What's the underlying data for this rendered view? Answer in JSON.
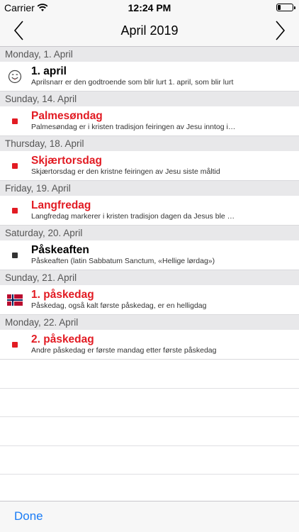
{
  "status_bar": {
    "carrier": "Carrier",
    "time": "12:24 PM",
    "battery_level": 0.22
  },
  "nav": {
    "title": "April 2019"
  },
  "colors": {
    "red": "#e21b23",
    "dark": "#333333",
    "link": "#1a7cf5"
  },
  "sections": [
    {
      "header": "Monday, 1. April",
      "event": {
        "title": "1. april",
        "subtitle": "Aprilsnarr er den godtroende som blir lurt 1. april, som blir lurt",
        "icon": "smiley-icon",
        "color": "#000000"
      }
    },
    {
      "header": "Sunday, 14. April",
      "event": {
        "title": "Palmesøndag",
        "subtitle": "Palmesøndag er i kristen tradisjon feiringen av Jesu inntog i Jerusalem",
        "icon": "red-square-icon",
        "color": "#e21b23"
      }
    },
    {
      "header": "Thursday, 18. April",
      "event": {
        "title": "Skjærtorsdag",
        "subtitle": "Skjærtorsdag er den kristne feiringen av Jesu siste måltid",
        "icon": "red-square-icon",
        "color": "#e21b23"
      }
    },
    {
      "header": "Friday, 19. April",
      "event": {
        "title": "Langfredag",
        "subtitle": "Langfredag markerer i kristen tradisjon dagen da Jesus ble korsfestet",
        "icon": "red-square-icon",
        "color": "#e21b23"
      }
    },
    {
      "header": "Saturday, 20. April",
      "event": {
        "title": "Påskeaften",
        "subtitle": "Påskeaften (latin Sabbatum Sanctum, «Hellige lørdag»)",
        "icon": "dark-square-icon",
        "color": "#000000"
      }
    },
    {
      "header": "Sunday, 21. April",
      "event": {
        "title": "1. påskedag",
        "subtitle": "Påskedag, også kalt første påskedag, er en helligdag",
        "icon": "norway-flag-icon",
        "color": "#e21b23"
      }
    },
    {
      "header": "Monday, 22. April",
      "event": {
        "title": "2. påskedag",
        "subtitle": "Andre påskedag er første mandag etter første påskedag",
        "icon": "red-square-icon",
        "color": "#e21b23"
      }
    }
  ],
  "toolbar": {
    "done_label": "Done"
  }
}
